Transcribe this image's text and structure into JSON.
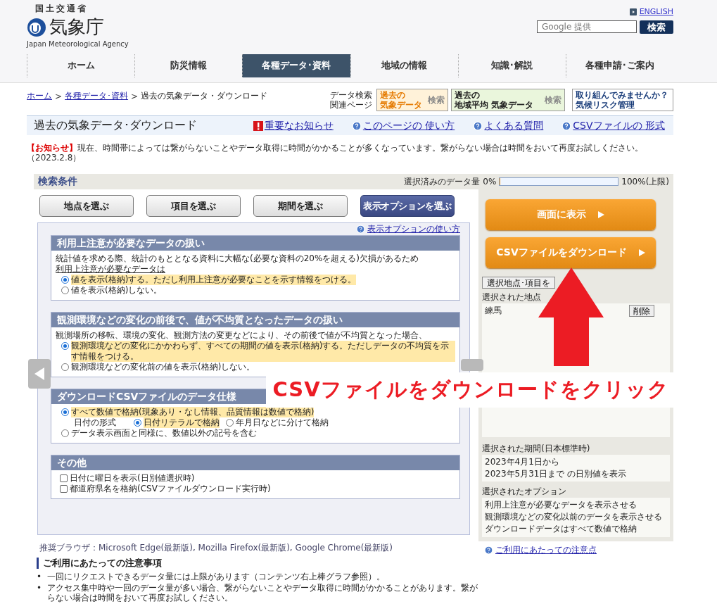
{
  "header": {
    "ministry": "国土交通省",
    "agency_name": "気象庁",
    "agency_name_en": "Japan Meteorological Agency",
    "english_link": "ENGLISH",
    "search": {
      "placeholder": "Google 提供"
    },
    "search_button": "検索"
  },
  "nav": [
    {
      "label": "ホーム",
      "selected": false
    },
    {
      "label": "防災情報",
      "selected": false
    },
    {
      "label": "各種データ･資料",
      "selected": true
    },
    {
      "label": "地域の情報",
      "selected": false
    },
    {
      "label": "知識･解説",
      "selected": false
    },
    {
      "label": "各種申請･ご案内",
      "selected": false
    }
  ],
  "breadcrumb": [
    {
      "kind": "link",
      "label": "ホーム"
    },
    {
      "kind": "separator",
      "label": ">"
    },
    {
      "kind": "link",
      "label": "各種データ･資料"
    },
    {
      "kind": "separator",
      "label": ">"
    },
    {
      "kind": "current",
      "label": "過去の気象データ・ダウンロード"
    }
  ],
  "related": {
    "label_lines": [
      "データ検索",
      "関連ページ"
    ],
    "banners": [
      {
        "kind": "past",
        "lines": [
          "過去の",
          "気象データ",
          "検索"
        ]
      },
      {
        "kind": "regional",
        "lines": [
          "過去の",
          "地域平均 気象データ",
          "検索"
        ]
      },
      {
        "kind": "risk",
        "lines": [
          "取り組んでみませんか？",
          "気候リスク管理"
        ]
      }
    ]
  },
  "title_bar": {
    "title": "過去の気象データ･ダウンロード",
    "links": [
      {
        "kind": "alert",
        "label": "重要なお知らせ"
      },
      {
        "kind": "help",
        "label": "このページの 使い方"
      },
      {
        "kind": "help",
        "label": "よくある質問"
      },
      {
        "kind": "help",
        "label": "CSVファイルの 形式"
      }
    ]
  },
  "notice": {
    "tag": "【お知らせ】",
    "text": "現在、時間帯によっては繋がらないことやデータ取得に時間がかかることが多くなっています。繋がらない場合は時間をおいて再度お試しください。",
    "date": "（2023.2.8）"
  },
  "search_panel": {
    "title": "検索条件",
    "quota": {
      "label": "選択済みのデータ量 0%",
      "level": 0,
      "max": "100%(上限)"
    },
    "tabs": [
      {
        "label": "地点を選ぶ",
        "selected": false
      },
      {
        "label": "項目を選ぶ",
        "selected": false
      },
      {
        "label": "期間を選ぶ",
        "selected": false
      },
      {
        "label": "表示オプションを選ぶ",
        "selected": true
      }
    ],
    "help_link": "表示オプションの使い方",
    "sections": [
      {
        "title": "利用上注意が必要なデータの扱い",
        "description": "統計値を求める際、統計のもととなる資料に大幅な(必要な資料の20%を超える)欠損があるため",
        "subheading": "利用上注意が必要なデータは",
        "options": [
          {
            "kind": "radio",
            "label": "値を表示(格納)する。ただし利用上注意が必要なことを示す情報をつける。",
            "selected": true
          },
          {
            "kind": "radio",
            "label": "値を表示(格納)しない。",
            "selected": false
          }
        ]
      },
      {
        "title": "観測環境などの変化の前後で、値が不均質となったデータの扱い",
        "description": "観測場所の移転、環境の変化、観測方法の変更などにより、その前後で値が不均質となった場合、",
        "options": [
          {
            "kind": "radio",
            "label": "観測環境などの変化にかかわらず、すべての期間の値を表示(格納)する。ただしデータの不均質を示す情報をつける。",
            "selected": true
          },
          {
            "kind": "radio",
            "label": "観測環境などの変化前の値を表示(格納)しない。",
            "selected": false
          }
        ]
      },
      {
        "title": "ダウンロードCSVファイルのデータ仕様",
        "options": [
          {
            "kind": "radio",
            "label": "すべて数値で格納(現象あり・なし情報、品質情報は数値で格納)",
            "selected": true
          },
          {
            "kind": "choice_row",
            "label": "日付の形式",
            "choices": [
              {
                "label": "日付リテラルで格納",
                "selected": true
              },
              {
                "label": "年月日などに分けて格納",
                "selected": false
              }
            ]
          },
          {
            "kind": "radio",
            "label": "データ表示画面と同様に、数値以外の記号を含む",
            "selected": false
          }
        ]
      },
      {
        "title": "その他",
        "options": [
          {
            "kind": "checkbox",
            "label": "日付に曜日を表示(日別値選択時)",
            "checked": false
          },
          {
            "kind": "checkbox",
            "label": "都道府県名を格納(CSVファイルダウンロード実行時)",
            "checked": false
          }
        ]
      }
    ]
  },
  "side_panel": {
    "actions": [
      "画面に表示",
      "CSVファイルをダウンロード"
    ],
    "clear_button": "選択地点･項目を",
    "stations": {
      "label": "選択された地点",
      "items": [
        {
          "name": "練馬",
          "delete": "削除"
        }
      ]
    },
    "period": {
      "label": "選択された期間(日本標準時)",
      "lines": [
        "2023年4月1日から",
        "2023年5月31日まで の日別値を表示"
      ]
    },
    "options": {
      "label": "選択されたオプション",
      "lines": [
        "利用上注意が必要なデータを表示させる",
        "観測環境などの変化以前のデータを表示させる",
        "ダウンロードデータはすべて数値で格納"
      ]
    },
    "notes_link": "ご利用にあたっての注意点"
  },
  "browsers": "推奨ブラウザ：Microsoft Edge(最新版), Mozilla Firefox(最新版), Google Chrome(最新版)",
  "notes": {
    "title": "ご利用にあたっての注意事項",
    "items": [
      {
        "marker": "•",
        "text": "一回にリクエストできるデータ量には上限があります（コンテンツ右上棒グラフ参照）。"
      },
      {
        "marker": "•",
        "text": "アクセス集中時や一回のデータ量が多い場合、繋がらないことやデータ取得に時間がかかることがあります。繋がらない場合は時間をおいて再度お試しください。"
      }
    ]
  },
  "callout": {
    "text": "CSVファイルをダウンロードをクリック"
  }
}
